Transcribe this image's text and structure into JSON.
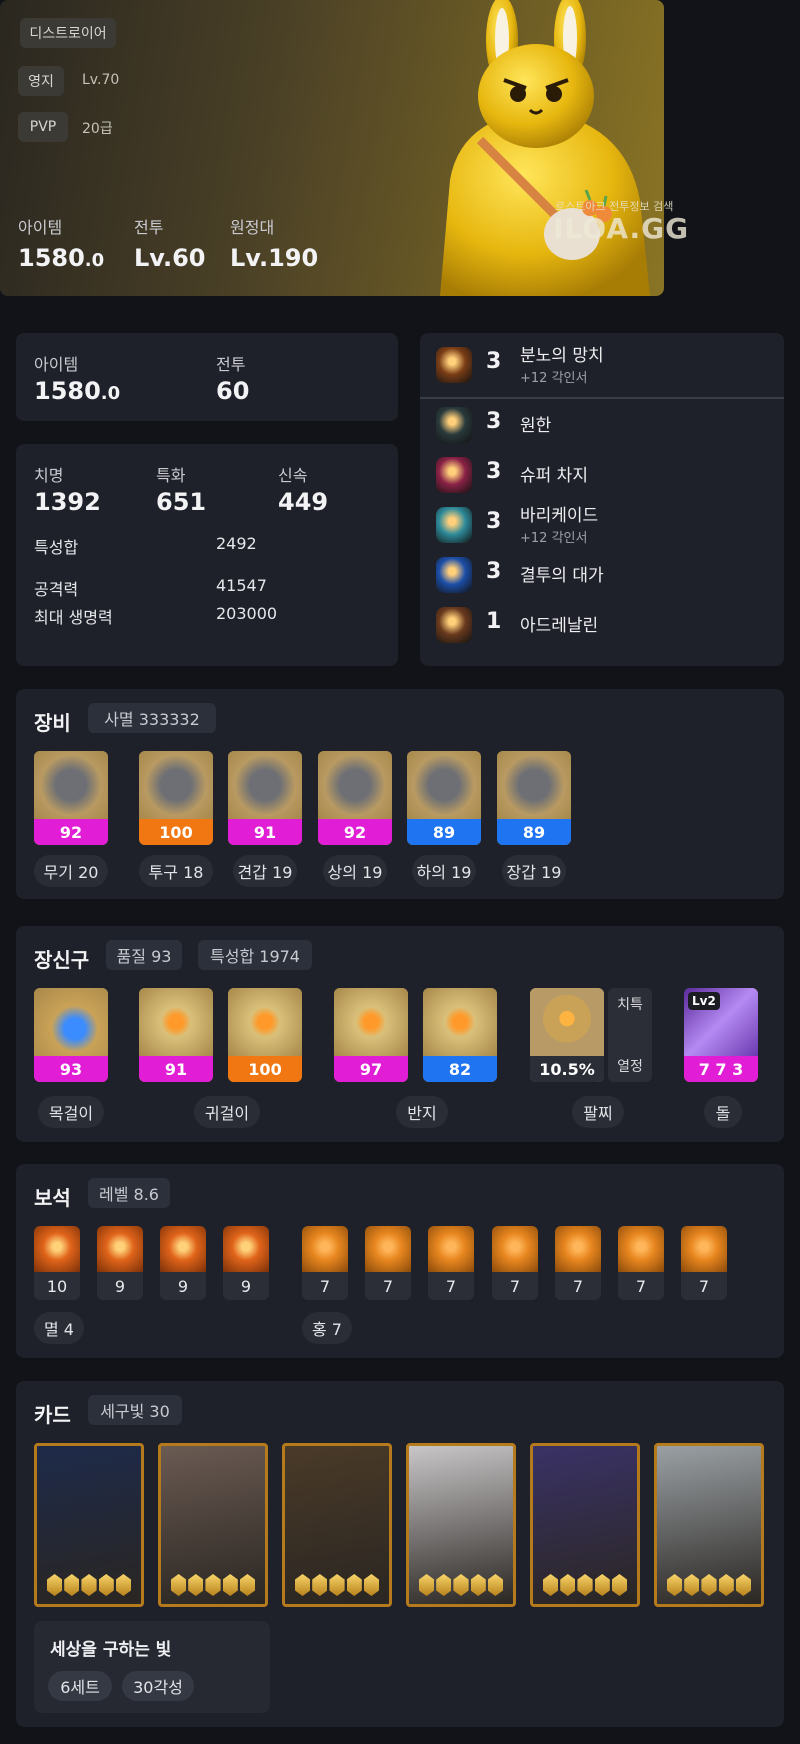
{
  "hero": {
    "class_name": "디스트로이어",
    "estate_label": "영지",
    "estate_value": "Lv.70",
    "pvp_label": "PVP",
    "pvp_value": "20급",
    "item_label": "아이템",
    "item_value": "1580",
    "item_decimal": ".0",
    "combat_label": "전투",
    "combat_value": "Lv.60",
    "expedition_label": "원정대",
    "expedition_value": "Lv.190",
    "watermark_sub": "로스트아크 전투정보 검색",
    "watermark": "ILOA.GG"
  },
  "levels": {
    "item_label": "아이템",
    "item_value": "1580",
    "item_decimal": ".0",
    "combat_label": "전투",
    "combat_value": "60"
  },
  "stats": {
    "crit_label": "치명",
    "crit_value": "1392",
    "spec_label": "특화",
    "spec_value": "651",
    "swift_label": "신속",
    "swift_value": "449",
    "sum_label": "특성합",
    "sum_value": "2492",
    "atk_label": "공격력",
    "atk_value": "41547",
    "hp_label": "최대 생명력",
    "hp_value": "203000"
  },
  "engravings": [
    {
      "level": "3",
      "name": "분노의 망치",
      "sub": "+12 각인서",
      "icon": "hammer-icon",
      "color": "#7a3d16"
    },
    {
      "level": "3",
      "name": "원한",
      "sub": "",
      "icon": "grudge-icon",
      "color": "#2a3a3c"
    },
    {
      "level": "3",
      "name": "슈퍼 차지",
      "sub": "",
      "icon": "super-charge-icon",
      "color": "#8a2246"
    },
    {
      "level": "3",
      "name": "바리케이드",
      "sub": "+12 각인서",
      "icon": "barricade-icon",
      "color": "#2e8a9a"
    },
    {
      "level": "3",
      "name": "결투의 대가",
      "sub": "",
      "icon": "master-brawler-icon",
      "color": "#1c4ea8"
    },
    {
      "level": "1",
      "name": "아드레날린",
      "sub": "",
      "icon": "adrenaline-icon",
      "color": "#6a3a1e"
    }
  ],
  "equipment": {
    "title": "장비",
    "tag": "사멸 333332",
    "items": [
      {
        "quality": "92",
        "label": "무기 20",
        "icon": "weapon-icon"
      },
      {
        "quality": "100",
        "label": "투구 18",
        "icon": "helmet-icon"
      },
      {
        "quality": "91",
        "label": "견갑 19",
        "icon": "shoulder-icon"
      },
      {
        "quality": "92",
        "label": "상의 19",
        "icon": "chest-icon"
      },
      {
        "quality": "89",
        "label": "하의 19",
        "icon": "pants-icon"
      },
      {
        "quality": "89",
        "label": "장갑 19",
        "icon": "gloves-icon"
      }
    ]
  },
  "accessories": {
    "title": "장신구",
    "tag1": "품질 93",
    "tag2": "특성합 1974",
    "items": [
      {
        "quality": "93",
        "icon": "necklace-icon"
      },
      {
        "quality": "91",
        "icon": "earring-icon"
      },
      {
        "quality": "100",
        "icon": "earring-icon"
      },
      {
        "quality": "97",
        "icon": "ring-icon"
      },
      {
        "quality": "82",
        "icon": "ring-icon"
      }
    ],
    "bracelet_value": "10.5%",
    "bracelet_stat1": "치특",
    "bracelet_stat2": "열정",
    "stone_level": "Lv2",
    "stone_value": "7 7 3",
    "labels": {
      "necklace": "목걸이",
      "earring": "귀걸이",
      "ring": "반지",
      "bracelet": "팔찌",
      "stone": "돌"
    }
  },
  "gems": {
    "title": "보석",
    "tag": "레벨 8.6",
    "doom": [
      "10",
      "9",
      "9",
      "9"
    ],
    "blaze": [
      "7",
      "7",
      "7",
      "7",
      "7",
      "7",
      "7"
    ],
    "doom_label": "멸 4",
    "blaze_label": "홍 7"
  },
  "cards": {
    "title": "카드",
    "tag": "세구빛 30",
    "set_name": "세상을 구하는 빛",
    "set_count": "6세트",
    "awaken": "30각성",
    "palette": [
      "#1d2a4a",
      "#6a5a52",
      "#4a3a28",
      "#c9c6c8",
      "#3a3266",
      "#9aa0a4"
    ]
  }
}
